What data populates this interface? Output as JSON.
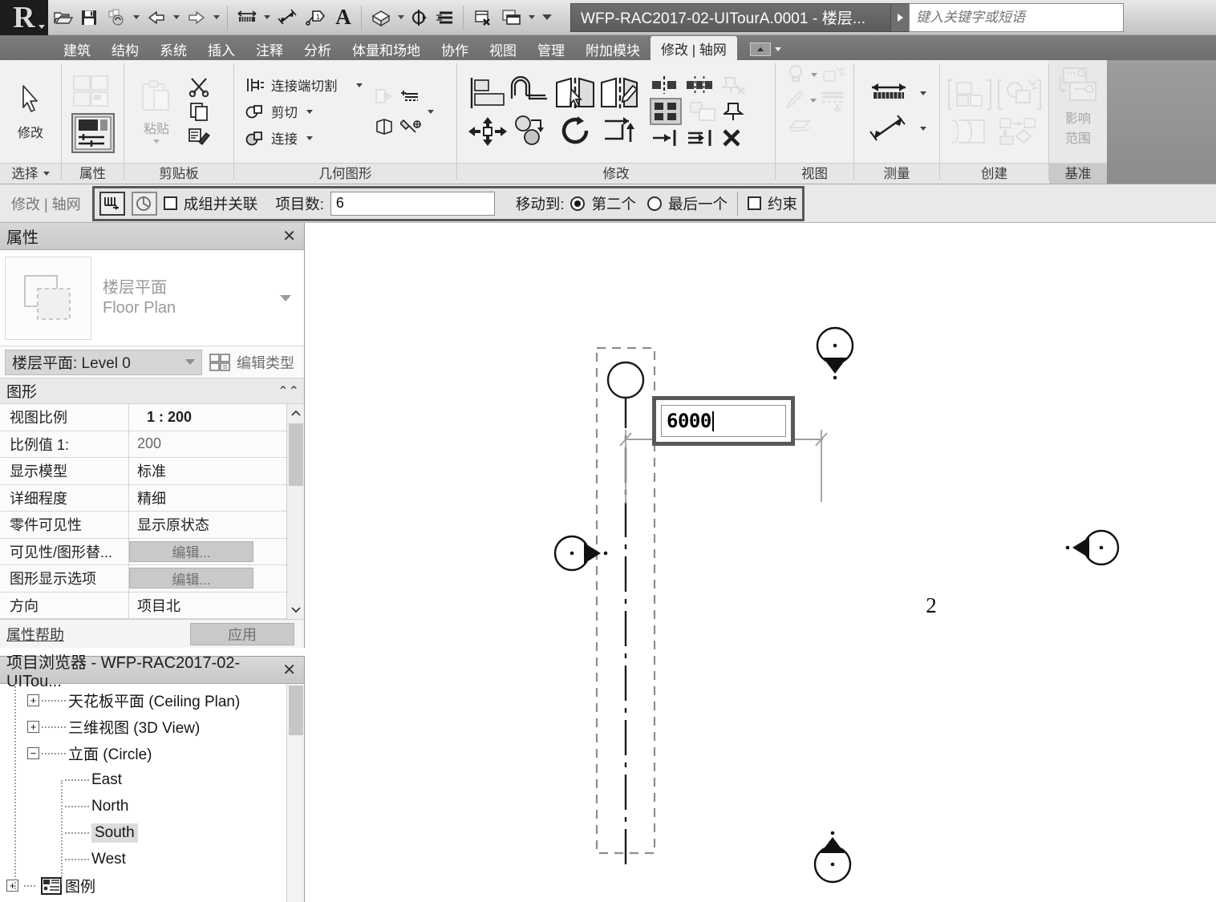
{
  "titlebar": {
    "logo_letter": "R",
    "document_title": "WFP-RAC2017-02-UITourA.0001 - 楼层...",
    "search_placeholder": "键入关键字或短语",
    "quick_access": [
      {
        "name": "open-icon",
        "label": "打开"
      },
      {
        "name": "save-icon",
        "label": "保存"
      },
      {
        "name": "sync-with-central-icon",
        "label": "与中心文件同步"
      },
      {
        "name": "undo-icon",
        "label": "放弃"
      },
      {
        "name": "redo-icon",
        "label": "重做"
      },
      {
        "name": "measure-icon",
        "label": "测量"
      },
      {
        "name": "aligned-dimension-icon",
        "label": "对齐尺寸标注"
      },
      {
        "name": "tag-icon",
        "label": "按类别标记"
      },
      {
        "name": "text-icon",
        "label": "文字"
      },
      {
        "name": "default-3d-view-icon",
        "label": "默认三维视图"
      },
      {
        "name": "section-icon",
        "label": "剖面"
      },
      {
        "name": "thin-lines-icon",
        "label": "细线"
      },
      {
        "name": "close-hidden-windows-icon",
        "label": "关闭隐藏窗口"
      },
      {
        "name": "switch-windows-icon",
        "label": "切换窗口"
      }
    ]
  },
  "ribbon": {
    "tabs": [
      {
        "label": "建筑",
        "active": false
      },
      {
        "label": "结构",
        "active": false
      },
      {
        "label": "系统",
        "active": false
      },
      {
        "label": "插入",
        "active": false
      },
      {
        "label": "注释",
        "active": false
      },
      {
        "label": "分析",
        "active": false
      },
      {
        "label": "体量和场地",
        "active": false
      },
      {
        "label": "协作",
        "active": false
      },
      {
        "label": "视图",
        "active": false
      },
      {
        "label": "管理",
        "active": false
      },
      {
        "label": "附加模块",
        "active": false
      },
      {
        "label": "修改 | 轴网",
        "active": true
      }
    ],
    "panels": {
      "select": {
        "label": "选择",
        "modify_label": "修改"
      },
      "properties": {
        "label": "属性"
      },
      "clipboard": {
        "label": "剪贴板",
        "paste_label": "粘贴"
      },
      "geometry": {
        "label": "几何图形",
        "items": [
          "连接端切割",
          "剪切",
          "连接"
        ]
      },
      "modify": {
        "label": "修改"
      },
      "view": {
        "label": "视图"
      },
      "measure": {
        "label": "测量"
      },
      "create": {
        "label": "创建"
      },
      "datum": {
        "label": "基准",
        "affect_line1": "影响",
        "affect_line2": "范围"
      }
    }
  },
  "options_bar": {
    "context_label": "修改 | 轴网",
    "group_and_associate": {
      "label": "成组并关联",
      "checked": false
    },
    "item_count": {
      "label": "项目数:",
      "value": "6"
    },
    "move_to": {
      "label": "移动到:",
      "options": [
        {
          "label": "第二个",
          "selected": true
        },
        {
          "label": "最后一个",
          "selected": false
        }
      ]
    },
    "constrain": {
      "label": "约束",
      "checked": false
    }
  },
  "properties_palette": {
    "title": "属性",
    "close_label": "✕",
    "type_name_cn": "楼层平面",
    "type_name_en": "Floor Plan",
    "instance_selector": "楼层平面: Level 0",
    "edit_type_label": "编辑类型",
    "group_header": "图形",
    "rows": [
      {
        "key": "视图比例",
        "value": "1 : 200",
        "kind": "bold"
      },
      {
        "key": "比例值 1:",
        "value": "200",
        "kind": "gray"
      },
      {
        "key": "显示模型",
        "value": "标准",
        "kind": "text"
      },
      {
        "key": "详细程度",
        "value": "精细",
        "kind": "text"
      },
      {
        "key": "零件可见性",
        "value": "显示原状态",
        "kind": "text"
      },
      {
        "key": "可见性/图形替...",
        "value": "编辑...",
        "kind": "button"
      },
      {
        "key": "图形显示选项",
        "value": "编辑...",
        "kind": "button"
      },
      {
        "key": "方向",
        "value": "项目北",
        "kind": "text"
      }
    ],
    "help_link": "属性帮助",
    "apply_button": "应用"
  },
  "project_browser": {
    "title": "项目浏览器 - WFP-RAC2017-02-UITou...",
    "close_label": "✕",
    "nodes": [
      {
        "label": "天花板平面 (Ceiling Plan)",
        "expander": "+",
        "depth": 1,
        "selected": false
      },
      {
        "label": "三维视图 (3D View)",
        "expander": "+",
        "depth": 1,
        "selected": false
      },
      {
        "label": "立面 (Circle)",
        "expander": "−",
        "depth": 1,
        "selected": false
      },
      {
        "label": "East",
        "expander": "",
        "depth": 2,
        "selected": false
      },
      {
        "label": "North",
        "expander": "",
        "depth": 2,
        "selected": false
      },
      {
        "label": "South",
        "expander": "",
        "depth": 2,
        "selected": true
      },
      {
        "label": "West",
        "expander": "",
        "depth": 2,
        "selected": false
      },
      {
        "label": "图例",
        "expander": "+",
        "depth": 0,
        "selected": false,
        "icon": "legend-icon"
      }
    ]
  },
  "canvas": {
    "grid_bubble_label": "2",
    "dimension_input_value": "6000",
    "elevation_markers": [
      {
        "name": "elevation-marker-north",
        "direction": "down"
      },
      {
        "name": "elevation-marker-west",
        "direction": "right"
      },
      {
        "name": "elevation-marker-east",
        "direction": "left"
      },
      {
        "name": "elevation-marker-south",
        "direction": "up"
      }
    ]
  },
  "colors": {
    "selection_border": "#585858",
    "ribbon_bg": "#f1f1f1",
    "tabstrip_bg": "#6e6e6e",
    "title_chip": "#6f6f6f",
    "grid_gray": "#9b9b9b"
  }
}
